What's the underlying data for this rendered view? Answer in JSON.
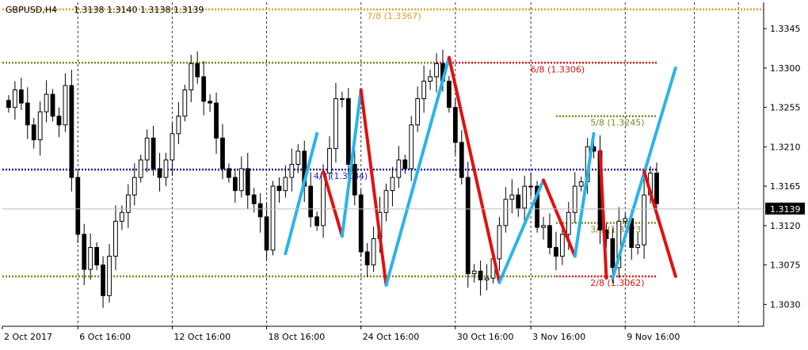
{
  "symbol_header": {
    "symbol": "GBPUSD,H4",
    "ohlc": "1.3138 1.3140 1.3138 1.3139"
  },
  "colors": {
    "background": "#ffffff",
    "candles": "#000000",
    "grid": "#000000",
    "up_leg": "#2ab4e8",
    "down_leg": "#e01010",
    "level_olive": "#7a8a1a",
    "level_red": "#e01010",
    "level_blue": "#1a1acc",
    "level_orange": "#e0a020",
    "price_label_bg": "#000000",
    "price_label_fg": "#ffffff"
  },
  "chart_data": {
    "type": "candlestick",
    "symbol": "GBPUSD",
    "timeframe": "H4",
    "current_price": 1.3139,
    "ylim": [
      1.3005,
      1.3375
    ],
    "x_range_bars": [
      0,
      121
    ],
    "y_ticks": [
      "1.3345",
      "1.3300",
      "1.3255",
      "1.3210",
      "1.3165",
      "1.3120",
      "1.3075",
      "1.3030"
    ],
    "x_ticks": [
      {
        "label": "2 Oct 2017",
        "bar": 0
      },
      {
        "label": "6 Oct 16:00",
        "bar": 12
      },
      {
        "label": "12 Oct 16:00",
        "bar": 27
      },
      {
        "label": "18 Oct 16:00",
        "bar": 42
      },
      {
        "label": "24 Oct 16:00",
        "bar": 57
      },
      {
        "label": "30 Oct 16:00",
        "bar": 72
      },
      {
        "label": "3 Nov 16:00",
        "bar": 84
      },
      {
        "label": "9 Nov 16:00",
        "bar": 99
      }
    ],
    "vertical_grid_bars": [
      12,
      27,
      42,
      57,
      72,
      84,
      99,
      110,
      117
    ],
    "close_series": [
      1.3255,
      1.3275,
      1.326,
      1.3235,
      1.3218,
      1.325,
      1.327,
      1.3245,
      1.3235,
      1.328,
      1.3175,
      1.311,
      1.307,
      1.3095,
      1.3075,
      1.304,
      1.3085,
      1.3125,
      1.3135,
      1.3155,
      1.3175,
      1.3195,
      1.322,
      1.3185,
      1.3175,
      1.3195,
      1.3225,
      1.3245,
      1.3275,
      1.3305,
      1.329,
      1.3262,
      1.326,
      1.322,
      1.3185,
      1.3175,
      1.316,
      1.3185,
      1.3155,
      1.3145,
      1.313,
      1.3092,
      1.3165,
      1.316,
      1.3175,
      1.319,
      1.3205,
      1.3165,
      1.313,
      1.312,
      1.318,
      1.3208,
      1.3265,
      1.3265,
      1.319,
      1.3155,
      1.309,
      1.3075,
      1.3105,
      1.3135,
      1.316,
      1.3175,
      1.3195,
      1.3185,
      1.3235,
      1.3265,
      1.3285,
      1.329,
      1.3305,
      1.3285,
      1.3255,
      1.3215,
      1.3175,
      1.3065,
      1.3068,
      1.3058,
      1.306,
      1.3082,
      1.312,
      1.315,
      1.3155,
      1.314,
      1.3165,
      1.3165,
      1.3118,
      1.312,
      1.3095,
      1.3085,
      1.311,
      1.3135,
      1.3165,
      1.317,
      1.321,
      1.3205,
      1.3115,
      1.3105,
      1.3072,
      1.3125,
      1.3128,
      1.3095,
      1.3098,
      1.3155,
      1.318,
      1.3145
    ],
    "levels": [
      {
        "label": "7/8 (1.3367)",
        "price": 1.3367,
        "color": "#e0a020",
        "bar_from": 0,
        "bar_to": 121
      },
      {
        "label": "6/8 (1.3306)",
        "price": 1.3306,
        "color": "#e01010",
        "bar_from": 69,
        "bar_to": 104
      },
      {
        "label": "",
        "price": 1.3306,
        "color": "#7a8a1a",
        "bar_from": 0,
        "bar_to": 69
      },
      {
        "label": "5/8 (1.3245)",
        "price": 1.3245,
        "color": "#7a8a1a",
        "bar_from": 88,
        "bar_to": 104
      },
      {
        "label": "4/8 (1.3184)",
        "price": 1.3184,
        "color": "#1a1acc",
        "bar_from": 0,
        "bar_to": 104
      },
      {
        "label": "3/8 (1.3123)",
        "price": 1.3123,
        "color": "#7a8a1a",
        "bar_from": 88,
        "bar_to": 104
      },
      {
        "label": "2/8 (1.3062)",
        "price": 1.3062,
        "color": "#e01010",
        "bar_from": 88,
        "bar_to": 104
      },
      {
        "label": "",
        "price": 1.3062,
        "color": "#7a8a1a",
        "bar_from": 0,
        "bar_to": 88
      }
    ],
    "zigzag_legs": [
      {
        "dir": "up",
        "from": [
          45,
          1.3088
        ],
        "to": [
          50,
          1.3225
        ]
      },
      {
        "dir": "down",
        "from": [
          51,
          1.3182
        ],
        "to": [
          54,
          1.3108
        ]
      },
      {
        "dir": "up",
        "from": [
          54,
          1.3108
        ],
        "to": [
          57,
          1.3275
        ]
      },
      {
        "dir": "down",
        "from": [
          57,
          1.3275
        ],
        "to": [
          61,
          1.3052
        ]
      },
      {
        "dir": "up",
        "from": [
          61,
          1.3052
        ],
        "to": [
          71,
          1.3312
        ]
      },
      {
        "dir": "down",
        "from": [
          71,
          1.3312
        ],
        "to": [
          79,
          1.3055
        ]
      },
      {
        "dir": "up",
        "from": [
          79,
          1.3055
        ],
        "to": [
          86,
          1.3172
        ]
      },
      {
        "dir": "down",
        "from": [
          86,
          1.3172
        ],
        "to": [
          91,
          1.3085
        ]
      },
      {
        "dir": "up",
        "from": [
          91,
          1.3085
        ],
        "to": [
          94,
          1.3225
        ]
      },
      {
        "dir": "down",
        "from": [
          95,
          1.3205
        ],
        "to": [
          96,
          1.306
        ]
      },
      {
        "dir": "up",
        "from": [
          97,
          1.306
        ],
        "to": [
          107,
          1.33
        ]
      },
      {
        "dir": "down",
        "from": [
          102,
          1.3182
        ],
        "to": [
          107,
          1.3062
        ]
      }
    ]
  }
}
